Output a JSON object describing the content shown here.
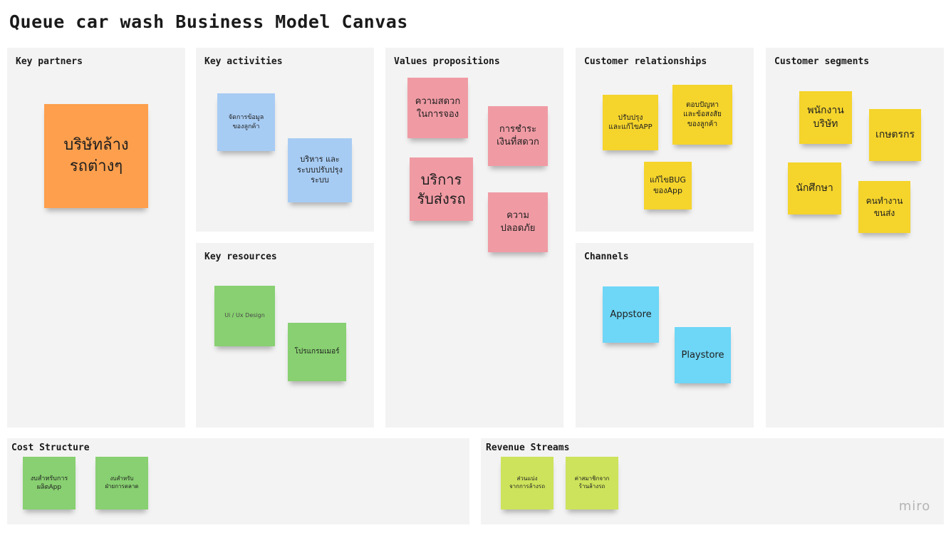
{
  "title": "Queue car wash Business Model Canvas",
  "panels": {
    "key_partners": {
      "label": "Key partners",
      "notes": [
        "บริษัทล้าง\nรถต่างๆ"
      ]
    },
    "key_activities": {
      "label": "Key activities",
      "notes": [
        "จัดการข้อมูล\nของลูกค้า",
        "บริหาร และ\nระบบปรับปรุง\nระบบ"
      ]
    },
    "key_resources": {
      "label": "Key resources",
      "notes": [
        "Ui / Ux Design",
        "โปรแกรมเมอร์"
      ]
    },
    "value_propositions": {
      "label": "Values propositions",
      "notes": [
        "ความสดวก\nในการจอง",
        "การชำระ\nเงินที่สดวก",
        "บริการ\nรับส่งรถ",
        "ความ\nปลอดภัย"
      ]
    },
    "customer_relationships": {
      "label": "Customer relationships",
      "notes": [
        "ปรับปรุง\nและแก้ไขAPP",
        "ตอบปัญหา\nและข้อสงสัย\nของลูกค้า",
        "แก้ไขBUG\nของApp"
      ]
    },
    "channels": {
      "label": "Channels",
      "notes": [
        "Appstore",
        "Playstore"
      ]
    },
    "customer_segments": {
      "label": "Customer segments",
      "notes": [
        "พนักงาน\nบริษัท",
        "เกษตรกร",
        "นักศึกษา",
        "คนทำงาน\nขนส่ง"
      ]
    },
    "cost_structure": {
      "label": "Cost Structure",
      "notes": [
        "งบสำหรับการ\nผลิตApp",
        "งบสำหรับ\nฝ่ายการตลาด"
      ]
    },
    "revenue_streams": {
      "label": "Revenue Streams",
      "notes": [
        "ส่วนแบ่ง\nจากการล้างรถ",
        "ค่าสมาชิกจาก\nร้านล้างรถ"
      ]
    }
  },
  "colors": {
    "orange": "#fd9f4d",
    "blue": "#a7ccf4",
    "green": "#88d071",
    "pink": "#f09ba4",
    "yellow": "#f5d42c",
    "cyan": "#6ed6f7",
    "lime": "#cde35c",
    "panel_bg": "#f3f3f3"
  },
  "watermark": "miro"
}
